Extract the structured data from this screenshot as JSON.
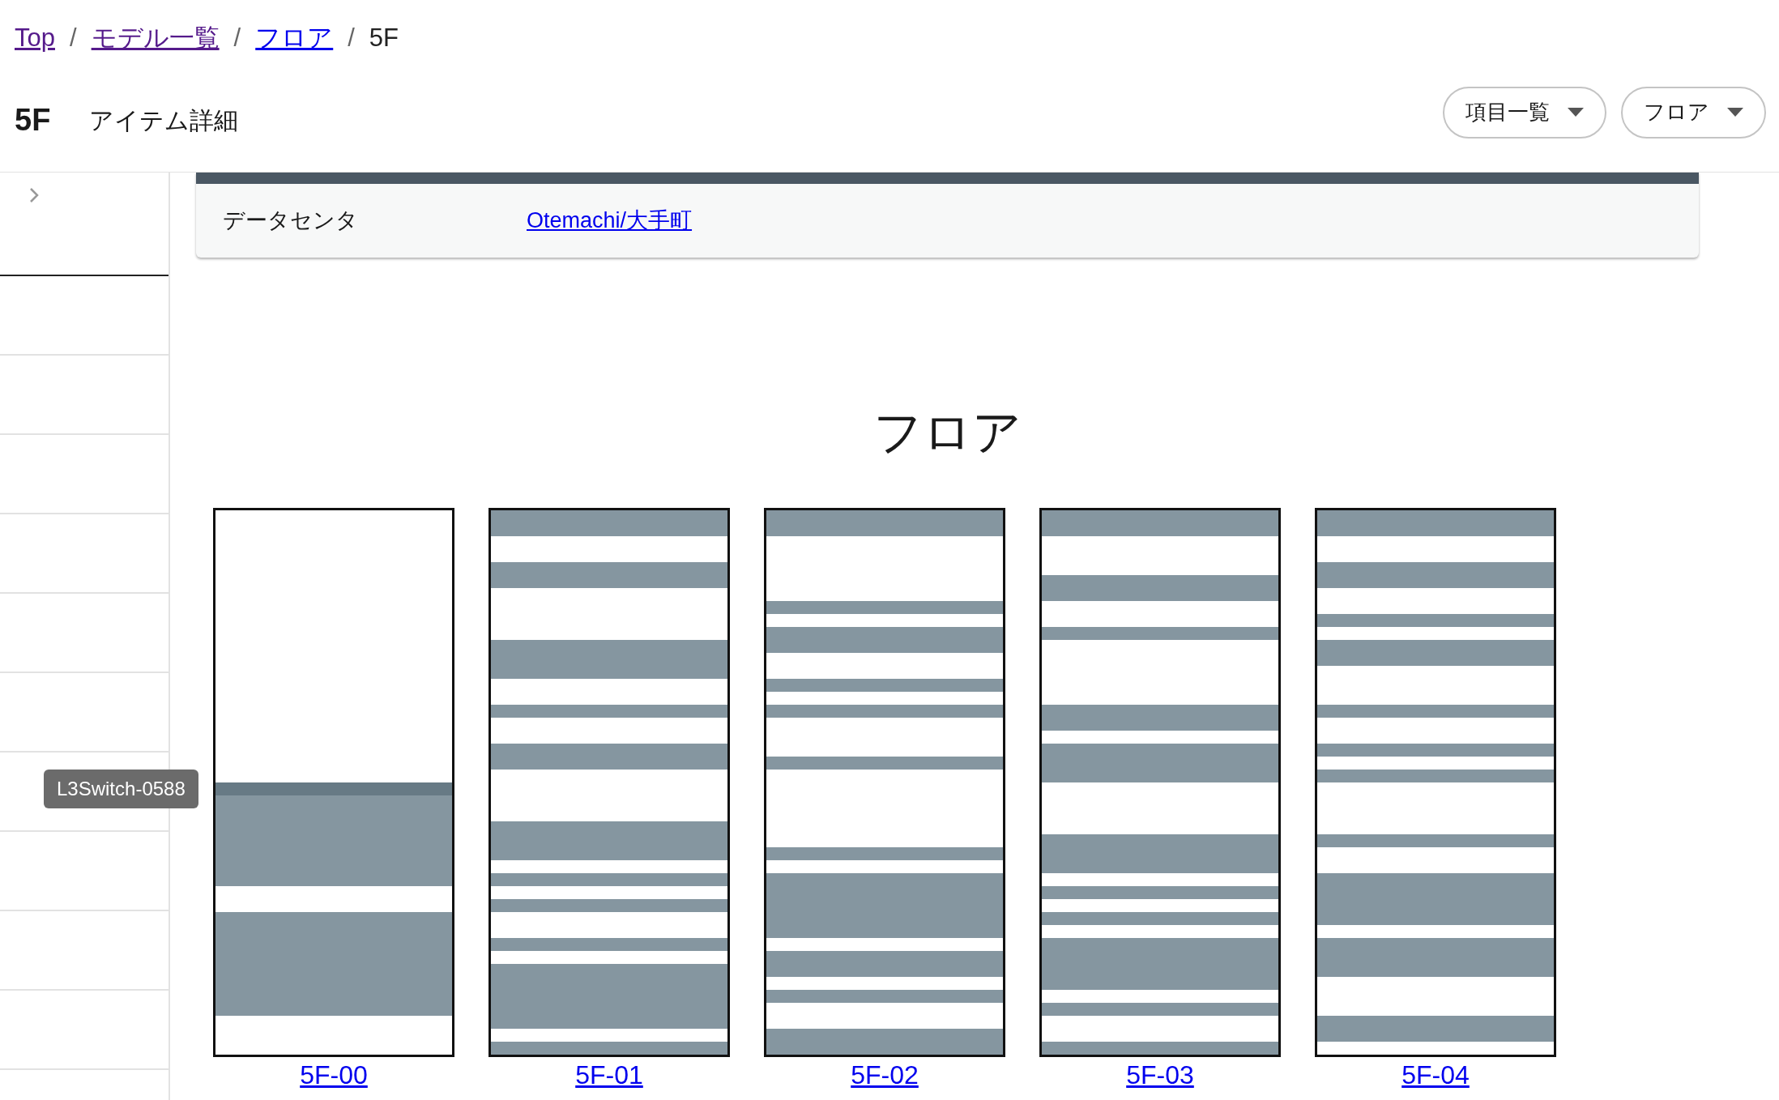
{
  "breadcrumbs": [
    {
      "label": "Top",
      "kind": "visited"
    },
    {
      "label": "モデル一覧",
      "kind": "visited"
    },
    {
      "label": "フロア",
      "kind": "link"
    },
    {
      "label": "5F",
      "kind": "current"
    }
  ],
  "breadcrumb_separators": [
    "/",
    "/",
    "/"
  ],
  "title": "5F",
  "subtitle": "アイテム詳細",
  "menus": [
    "項目一覧",
    "フロア"
  ],
  "details": [
    {
      "label": "データセンタ",
      "value": "Otemachi/大手町"
    }
  ],
  "floor": {
    "heading": "フロア",
    "racks": [
      {
        "label": "5F-00",
        "tooltip": "L3Switch-0588"
      },
      {
        "label": "5F-01"
      },
      {
        "label": "5F-02"
      },
      {
        "label": "5F-03"
      },
      {
        "label": "5F-04"
      }
    ]
  }
}
